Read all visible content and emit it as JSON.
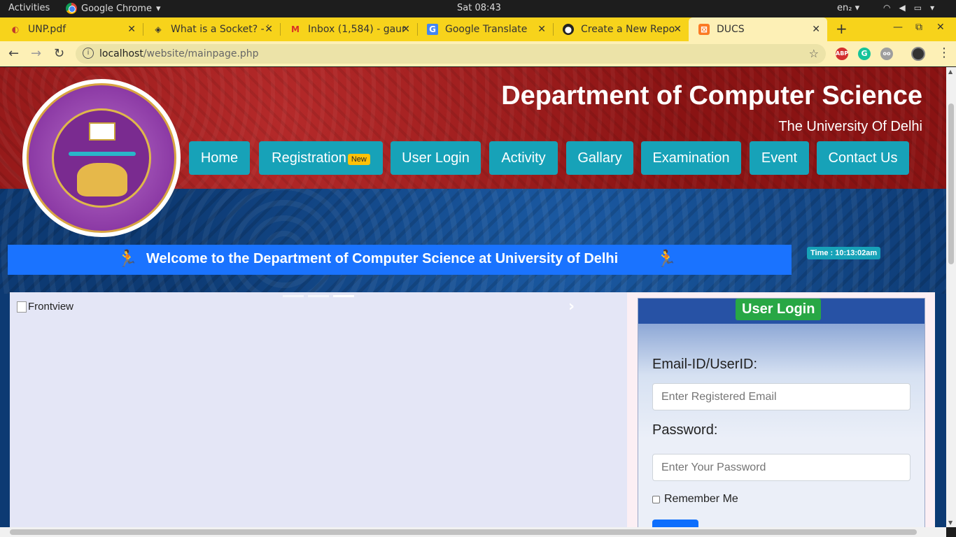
{
  "os": {
    "activities": "Activities",
    "app_name": "Google Chrome",
    "clock": "Sat 08:43",
    "lang": "en₂ ▾"
  },
  "tabs": [
    {
      "title": "UNP.pdf",
      "icon": "pdf-icon",
      "active": false
    },
    {
      "title": "What is a Socket? - T",
      "icon": "socket-site-icon",
      "active": false
    },
    {
      "title": "Inbox (1,584) - gaur",
      "icon": "gmail-icon",
      "active": false
    },
    {
      "title": "Google Translate",
      "icon": "translate-icon",
      "active": false
    },
    {
      "title": "Create a New Repo",
      "icon": "github-icon",
      "active": false
    },
    {
      "title": "DUCS",
      "icon": "xampp-icon",
      "active": true
    }
  ],
  "address": {
    "host": "localhost",
    "path": "/website/mainpage.php"
  },
  "extensions": [
    "ABP",
    "G",
    "oo"
  ],
  "site": {
    "title": "Department of Computer Science",
    "subtitle": "The University Of Delhi",
    "nav": [
      {
        "label": "Home"
      },
      {
        "label": "Registration",
        "badge": "New"
      },
      {
        "label": "User Login"
      },
      {
        "label": "Activity"
      },
      {
        "label": "Gallary"
      },
      {
        "label": "Examination"
      },
      {
        "label": "Event"
      },
      {
        "label": "Contact Us"
      }
    ],
    "marquee": "Welcome to the Department of Computer Science at University of Delhi",
    "time": "Time : 10:13:02am",
    "carousel_alt": "Frontview",
    "login": {
      "title": "User Login",
      "email_label": "Email-ID/UserID:",
      "email_placeholder": "Enter Registered Email",
      "password_label": "Password:",
      "password_placeholder": "Enter Your Password",
      "remember": "Remember Me"
    }
  },
  "colors": {
    "tab_bar": "#f7d31b",
    "nav_button": "#17a2b8",
    "marquee": "#1a73ff",
    "login_badge": "#28a745"
  }
}
